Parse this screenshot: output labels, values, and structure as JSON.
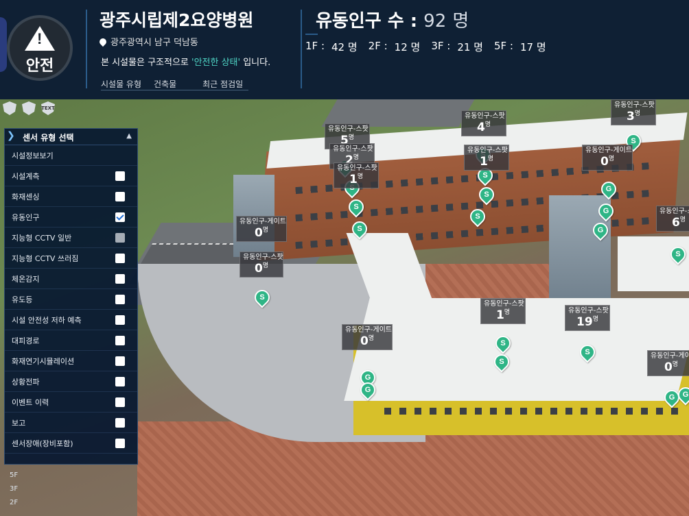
{
  "header": {
    "safety_badge": "안전",
    "facility_name": "광주시립제2요양병원",
    "address": "광주광역시 남구 덕남동",
    "status": {
      "prefix": "본 시설물은 구조적으로 ",
      "highlight": "'안전한 상태'",
      "suffix": " 입니다."
    },
    "meta": {
      "type_label": "시설물 유형",
      "type_value": "건축물",
      "inspection_label": "최근 점검일"
    },
    "population": {
      "title": "유동인구 수 :",
      "count": "92",
      "unit": "명",
      "floors": [
        {
          "floor": "1F :",
          "count": "42 명"
        },
        {
          "floor": "2F :",
          "count": "12 명"
        },
        {
          "floor": "3F :",
          "count": "21 명"
        },
        {
          "floor": "5F :",
          "count": "17 명"
        }
      ]
    }
  },
  "toolbar": {
    "text_icon_label": "TEXT"
  },
  "panel": {
    "title": "센서 유형 선택",
    "facility_info": "시설정보보기",
    "items": [
      {
        "label": "시설계측",
        "checked": false
      },
      {
        "label": "화재센싱",
        "checked": false
      },
      {
        "label": "유동인구",
        "checked": true
      },
      {
        "label": "지능형 CCTV 일반",
        "checked": false,
        "disabled": true
      },
      {
        "label": "지능형 CCTV 쓰러짐",
        "checked": false
      },
      {
        "label": "체온감지",
        "checked": false
      },
      {
        "label": "유도등",
        "checked": false
      },
      {
        "label": "시설 안전성 저하 예측",
        "checked": false
      },
      {
        "label": "대피경로",
        "checked": false
      },
      {
        "label": "화재연기시뮬레이션",
        "checked": false
      },
      {
        "label": "상황전파",
        "checked": false
      },
      {
        "label": "이벤트 이력",
        "checked": false
      },
      {
        "label": "보고",
        "checked": false
      },
      {
        "label": "센서장애(장비포함)",
        "checked": false
      }
    ]
  },
  "floor_nav": [
    "5F",
    "3F",
    "2F"
  ],
  "sensors": [
    {
      "name": "유동인구-스팟",
      "value": "5",
      "unit": "명"
    },
    {
      "name": "유동인구-스팟",
      "value": "2",
      "unit": "명"
    },
    {
      "name": "유동인구-스팟",
      "value": "1",
      "unit": "명"
    },
    {
      "name": "유동인구-스팟",
      "value": "4",
      "unit": "명"
    },
    {
      "name": "유동인구-스팟",
      "value": "1",
      "unit": "명"
    },
    {
      "name": "유동인구-스팟",
      "value": "3",
      "unit": "명"
    },
    {
      "name": "유동인구-게이트",
      "value": "0",
      "unit": "명"
    },
    {
      "name": "유동인구-게이트",
      "value": "0",
      "unit": "명"
    },
    {
      "name": "유동인구-스팟",
      "value": "0",
      "unit": "명"
    },
    {
      "name": "유동인구-스팟",
      "value": "6",
      "unit": "명"
    },
    {
      "name": "유동인구-스팟",
      "value": "1",
      "unit": "명"
    },
    {
      "name": "유동인구-스팟",
      "value": "19",
      "unit": "명"
    },
    {
      "name": "유동인구-게이트",
      "value": "0",
      "unit": "명"
    },
    {
      "name": "유동인구-게이트",
      "value": "0",
      "unit": "명"
    }
  ],
  "markers": {
    "spot": "S",
    "gate": "G"
  },
  "colors": {
    "marker": "#2fb586",
    "header_bg": "#0f2034",
    "panel_bg": "#061830",
    "highlight": "#4fd6c6"
  }
}
